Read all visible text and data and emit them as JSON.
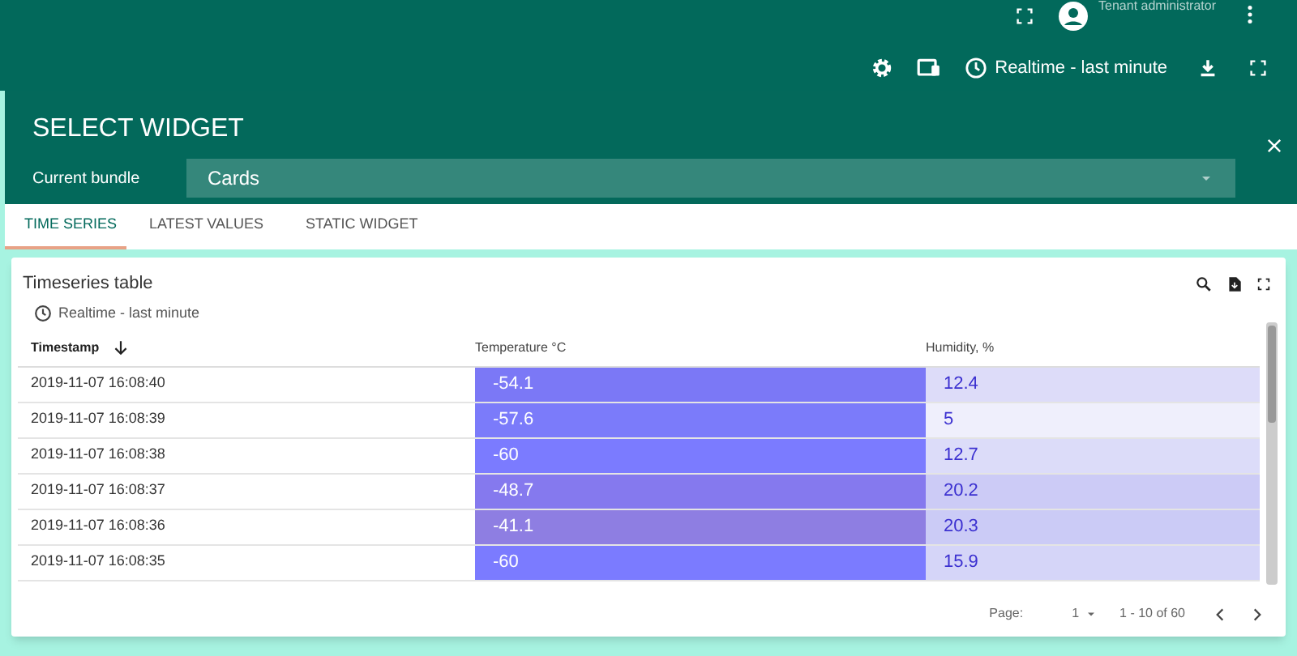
{
  "top_bar": {
    "user_label": "Tenant administrator",
    "timewindow": "Realtime - last minute"
  },
  "dialog": {
    "title": "SELECT WIDGET",
    "bundle_label": "Current bundle",
    "bundle_value": "Cards"
  },
  "tabs": [
    {
      "label": "TIME SERIES",
      "selected": true
    },
    {
      "label": "LATEST VALUES",
      "selected": false
    },
    {
      "label": "STATIC WIDGET",
      "selected": false
    }
  ],
  "widget": {
    "title": "Timeseries table",
    "timewindow": "Realtime - last minute",
    "table": {
      "columns": [
        "Timestamp",
        "Temperature °C",
        "Humidity, %"
      ],
      "rows": [
        {
          "timestamp": "2019-11-07 16:08:40",
          "temperature": {
            "value": "-54.1",
            "color": "#7b78f6"
          },
          "humidity": {
            "value": "12.4",
            "color": "#dddcf9"
          }
        },
        {
          "timestamp": "2019-11-07 16:08:39",
          "temperature": {
            "value": "-57.6",
            "color": "#7b7bfa"
          },
          "humidity": {
            "value": "5",
            "color": "#efeffc"
          }
        },
        {
          "timestamp": "2019-11-07 16:08:38",
          "temperature": {
            "value": "-60",
            "color": "#7b7bff"
          },
          "humidity": {
            "value": "12.7",
            "color": "#dcdcf9"
          }
        },
        {
          "timestamp": "2019-11-07 16:08:37",
          "temperature": {
            "value": "-48.7",
            "color": "#8579ee"
          },
          "humidity": {
            "value": "20.2",
            "color": "#cccbf6"
          }
        },
        {
          "timestamp": "2019-11-07 16:08:36",
          "temperature": {
            "value": "-41.1",
            "color": "#8e7ee2"
          },
          "humidity": {
            "value": "20.3",
            "color": "#cbcbf6"
          }
        },
        {
          "timestamp": "2019-11-07 16:08:35",
          "temperature": {
            "value": "-60",
            "color": "#7b7bff"
          },
          "humidity": {
            "value": "15.9",
            "color": "#d5d5f8"
          }
        }
      ]
    },
    "paginator": {
      "page_label": "Page:",
      "page": "1",
      "range": "1 - 10 of 60"
    }
  }
}
